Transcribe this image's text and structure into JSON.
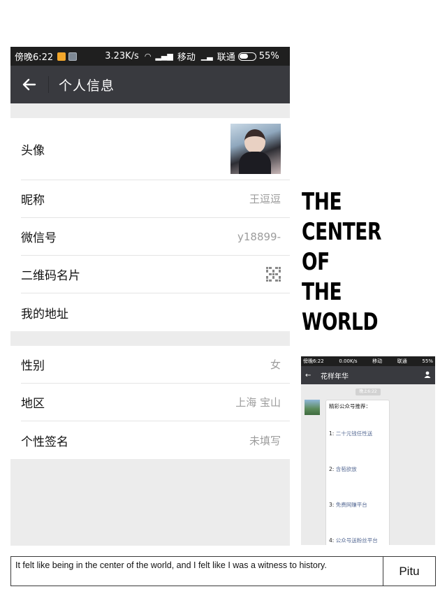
{
  "status_bar": {
    "time": "傍晚6:22",
    "speed": "3.23K/s",
    "wifi_icon": "wifi-icon",
    "signal_icon": "signal-icon",
    "carrier1": "移动",
    "carrier2": "联通",
    "battery": "55%"
  },
  "nav": {
    "back_icon": "arrow-left-icon",
    "title": "个人信息"
  },
  "profile": {
    "avatar_label": "头像",
    "nickname_label": "昵称",
    "nickname_value": "王逗逗",
    "wechat_id_label": "微信号",
    "wechat_id_value": "y18899-",
    "qr_label": "二维码名片",
    "address_label": "我的地址",
    "gender_label": "性别",
    "gender_value": "女",
    "region_label": "地区",
    "region_value": "上海 宝山",
    "signature_label": "个性签名",
    "signature_value": "未填写"
  },
  "headline": [
    "THE",
    "CENTER",
    "OF",
    "THE",
    "WORLD"
  ],
  "mini_chat": {
    "status_time": "傍晚6:22",
    "status_speed": "0.00K/s",
    "status_carrier1": "移动",
    "status_carrier2": "联通",
    "status_battery": "55%",
    "title": "花样年华",
    "timestamp": "晚上6:22",
    "message_header": "精彩公众号推荐：",
    "items": [
      {
        "num": "1:",
        "text": "二十元钱任性送"
      },
      {
        "num": "2:",
        "text": "含苞欲放"
      },
      {
        "num": "3:",
        "text": "免费网赚平台"
      },
      {
        "num": "4:",
        "text": "公众号送粉丝平台"
      }
    ]
  },
  "caption": {
    "text": "It felt like being in the center of the world, and I felt like I was a witness to history.",
    "brand": "Pitu"
  },
  "colors": {
    "nav_bg": "#393a3f",
    "status_bg": "#1f1f1f",
    "page_bg": "#ececec",
    "link": "#576b95"
  }
}
